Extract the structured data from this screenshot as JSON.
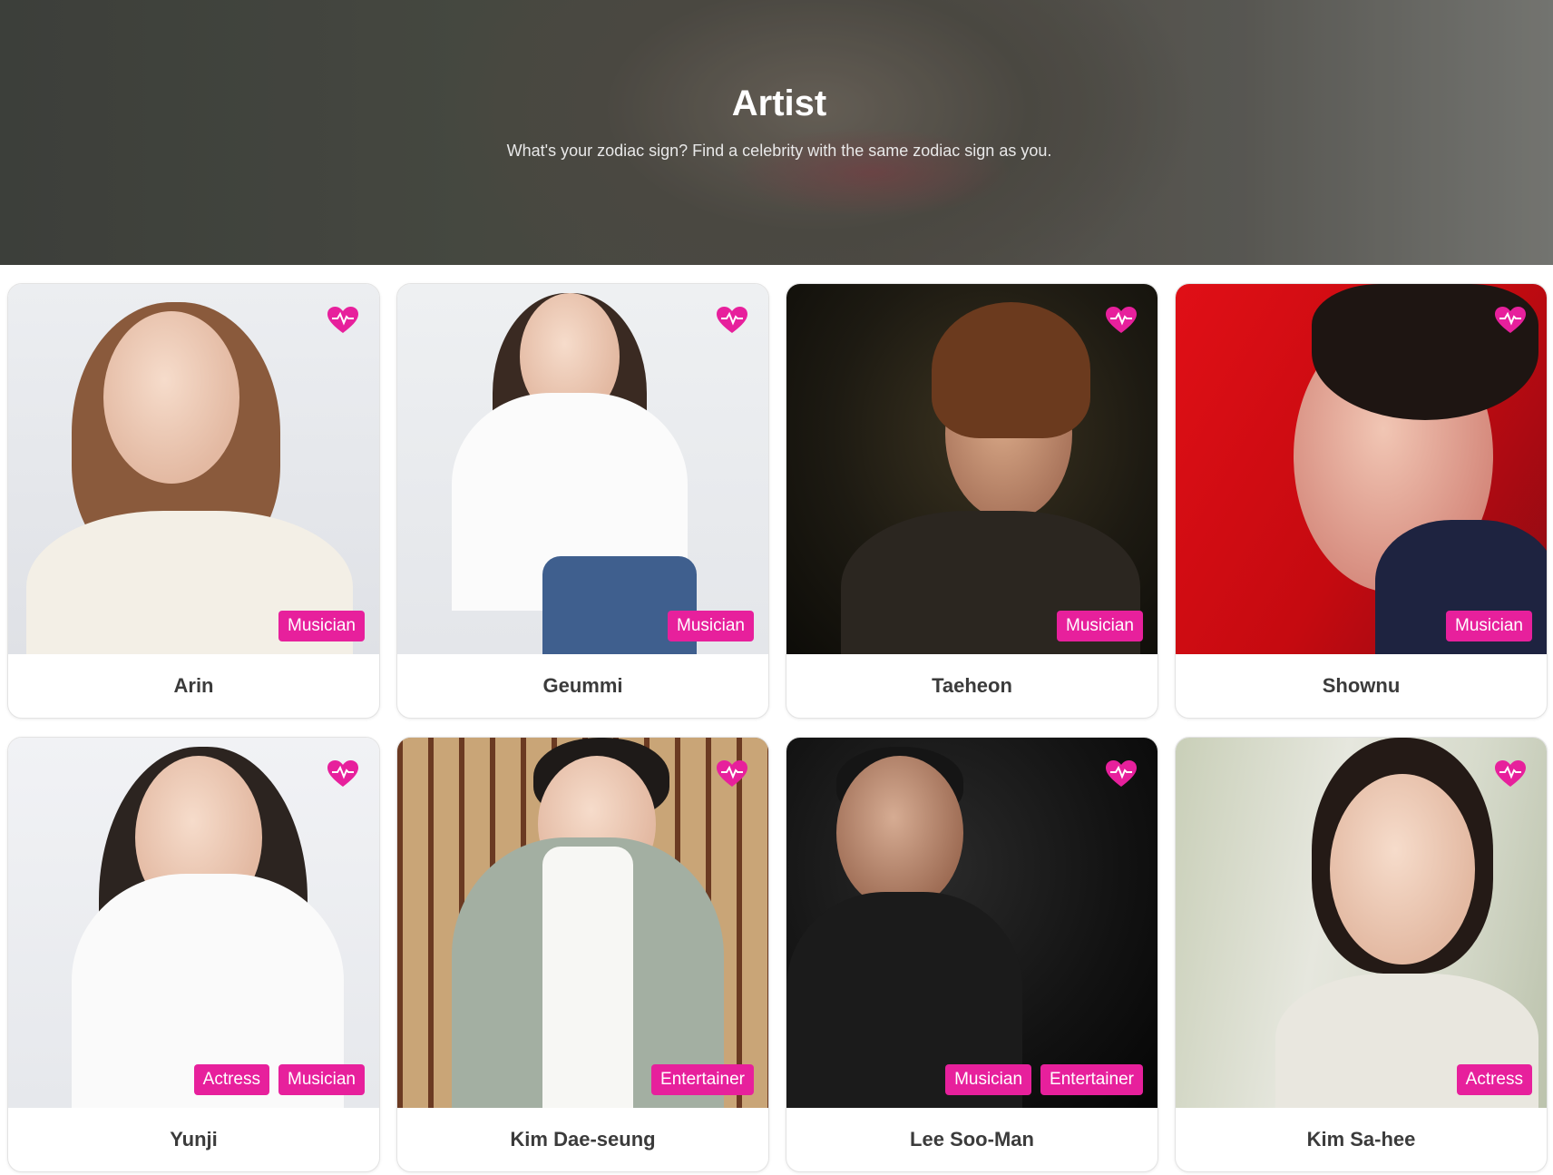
{
  "hero": {
    "title": "Artist",
    "subtitle": "What's your zodiac sign? Find a celebrity with the same zodiac sign as you."
  },
  "accent_color": "#e7209c",
  "artists": [
    {
      "name": "Arin",
      "tags": [
        "Musician"
      ]
    },
    {
      "name": "Geummi",
      "tags": [
        "Musician"
      ]
    },
    {
      "name": "Taeheon",
      "tags": [
        "Musician"
      ]
    },
    {
      "name": "Shownu",
      "tags": [
        "Musician"
      ]
    },
    {
      "name": "Yunji",
      "tags": [
        "Actress",
        "Musician"
      ]
    },
    {
      "name": "Kim Dae-seung",
      "tags": [
        "Entertainer"
      ]
    },
    {
      "name": "Lee Soo-Man",
      "tags": [
        "Musician",
        "Entertainer"
      ]
    },
    {
      "name": "Kim Sa-hee",
      "tags": [
        "Actress"
      ]
    }
  ],
  "icons": {
    "favorite": "heart-pulse-icon"
  }
}
